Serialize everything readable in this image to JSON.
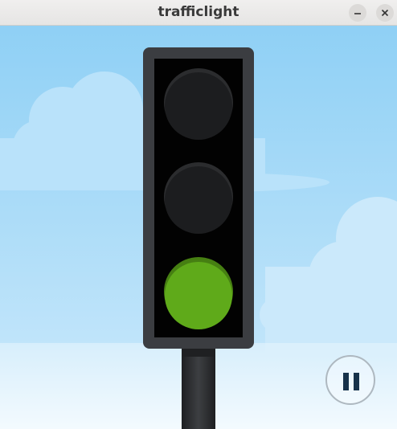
{
  "window": {
    "title": "trafficlight",
    "minimize_icon": "minimize-icon",
    "close_icon": "close-icon"
  },
  "traffic_light": {
    "active_lamp": "green",
    "lamps": [
      {
        "name": "red",
        "lit": false
      },
      {
        "name": "yellow",
        "lit": false
      },
      {
        "name": "green",
        "lit": true
      }
    ]
  },
  "controls": {
    "pause_icon": "pause-icon"
  },
  "colors": {
    "sky_top": "#8fd0f5",
    "sky_bottom": "#ffffff",
    "lamp_off": "#1c1d1f",
    "lamp_green": "#5faa1a",
    "housing": "#3b3d41",
    "pause_icon": "#16324a"
  }
}
